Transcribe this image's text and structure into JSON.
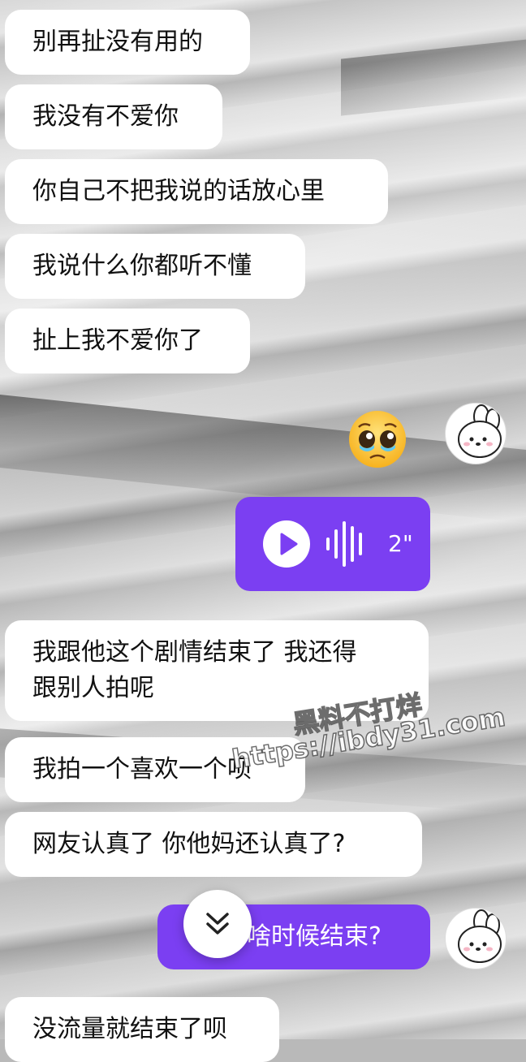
{
  "messages": {
    "m1": "别再扯没有用的",
    "m2": "我没有不爱你",
    "m3": "你自己不把我说的话放心里",
    "m4": "我说什么你都听不懂",
    "m5": "扯上我不爱你了",
    "m6_line1": "我跟他这个剧情结束了 我还得",
    "m6_line2": "跟别人拍呢",
    "m7": "我拍一个喜欢一个呗",
    "m8": "网友认真了 你他妈还认真了?",
    "m9": "啥时候结束?",
    "m10": "没流量就结束了呗"
  },
  "voice_message": {
    "duration": "2\""
  },
  "sticker": {
    "icon": "pleading-face-emoji"
  },
  "avatar": {
    "icon": "white-bunny-avatar"
  },
  "scroll_button": {
    "icon": "double-chevron-down-icon"
  },
  "watermark": {
    "line1": "黑料不打烊",
    "line2": "https://ibdy31.com"
  },
  "colors": {
    "purple_bubble": "#7b3ff2",
    "white_bubble": "#ffffff"
  }
}
